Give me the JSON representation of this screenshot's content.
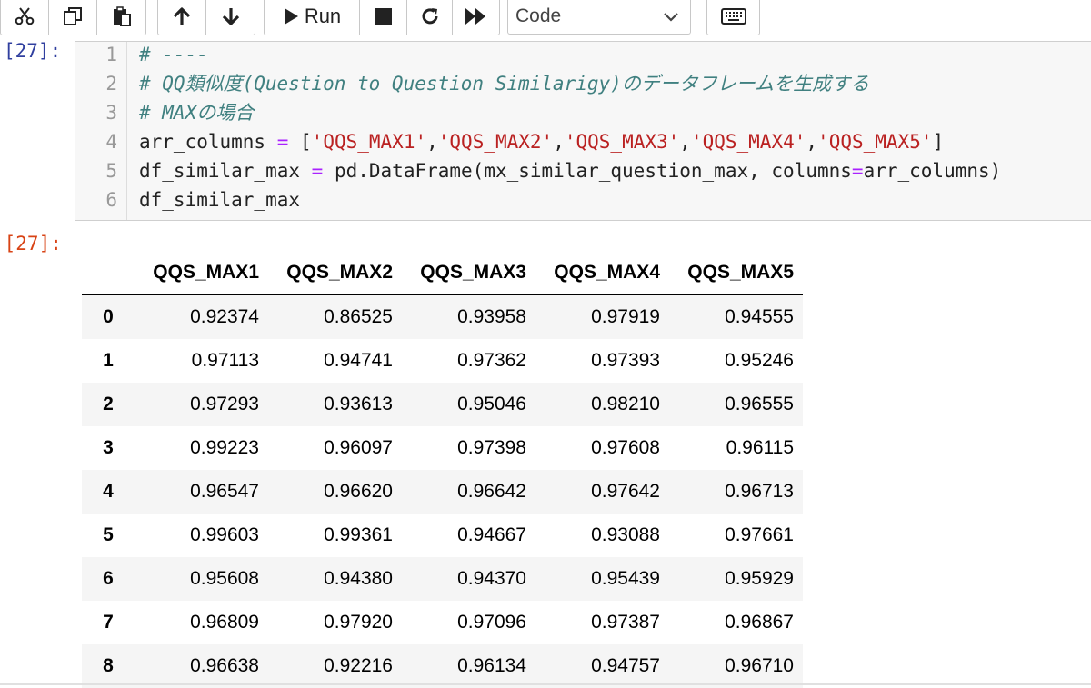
{
  "toolbar": {
    "run_label": "Run",
    "cell_type": "Code",
    "icons": [
      "cut-icon",
      "copy-icon",
      "paste-icon",
      "move-up-icon",
      "move-down-icon",
      "run-icon",
      "stop-icon",
      "restart-icon",
      "fast-forward-icon",
      "keyboard-icon"
    ]
  },
  "cell": {
    "in_prompt": "[27]:",
    "out_prompt": ":[27]:",
    "line_numbers": [
      "1",
      "2",
      "3",
      "4",
      "5",
      "6"
    ],
    "code": {
      "l1": "# ----",
      "l2": "# QQ類似度(Question to Question Similarigy)のデータフレームを生成する",
      "l3": "# MAXの場合",
      "l4_a": "arr_columns ",
      "l4_op": "=",
      "l4_b": " [",
      "l4_s1": "'QQS_MAX1'",
      "l4_s2": "'QQS_MAX2'",
      "l4_s3": "'QQS_MAX3'",
      "l4_s4": "'QQS_MAX4'",
      "l4_s5": "'QQS_MAX5'",
      "l4_comma": ",",
      "l4_end": "]",
      "l5_a": "df_similar_max ",
      "l5_op": "=",
      "l5_b": " pd.DataFrame(mx_similar_question_max, columns",
      "l5_op2": "=",
      "l5_c": "arr_columns)",
      "l6": "df_similar_max"
    }
  },
  "table": {
    "columns": [
      "QQS_MAX1",
      "QQS_MAX2",
      "QQS_MAX3",
      "QQS_MAX4",
      "QQS_MAX5"
    ],
    "rows": [
      {
        "index": "0",
        "values": [
          "0.92374",
          "0.86525",
          "0.93958",
          "0.97919",
          "0.94555"
        ]
      },
      {
        "index": "1",
        "values": [
          "0.97113",
          "0.94741",
          "0.97362",
          "0.97393",
          "0.95246"
        ]
      },
      {
        "index": "2",
        "values": [
          "0.97293",
          "0.93613",
          "0.95046",
          "0.98210",
          "0.96555"
        ]
      },
      {
        "index": "3",
        "values": [
          "0.99223",
          "0.96097",
          "0.97398",
          "0.97608",
          "0.96115"
        ]
      },
      {
        "index": "4",
        "values": [
          "0.96547",
          "0.96620",
          "0.96642",
          "0.97642",
          "0.96713"
        ]
      },
      {
        "index": "5",
        "values": [
          "0.99603",
          "0.99361",
          "0.94667",
          "0.93088",
          "0.97661"
        ]
      },
      {
        "index": "6",
        "values": [
          "0.95608",
          "0.94380",
          "0.94370",
          "0.95439",
          "0.95929"
        ]
      },
      {
        "index": "7",
        "values": [
          "0.96809",
          "0.97920",
          "0.97096",
          "0.97387",
          "0.96867"
        ]
      },
      {
        "index": "8",
        "values": [
          "0.96638",
          "0.92216",
          "0.96134",
          "0.94757",
          "0.96710"
        ]
      }
    ]
  },
  "colors": {
    "in_prompt": "#303f9f",
    "out_prompt": "#d84315",
    "comment": "#408080",
    "string": "#ba2121",
    "operator": "#aa22ff"
  }
}
